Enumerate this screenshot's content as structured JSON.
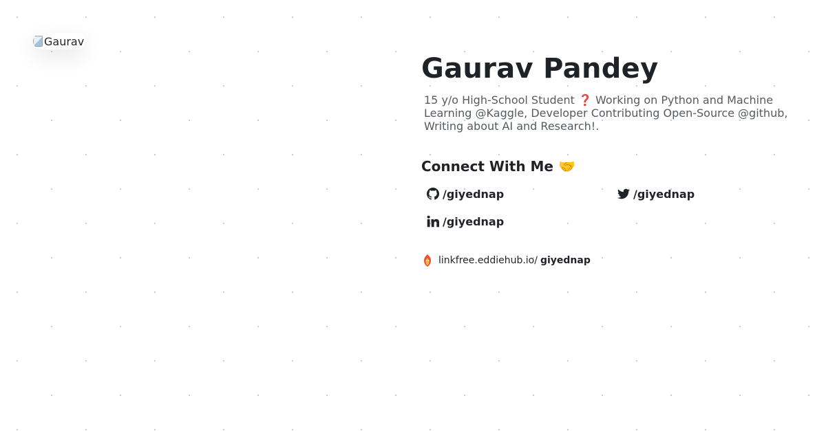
{
  "profile": {
    "avatar_alt": "Gaurav",
    "name": "Gaurav Pandey",
    "bio": "15 y/o High-School Student ❓ Working on Python and Machine Learning @Kaggle, Developer Contributing Open-Source @github, Writing about AI and Research!."
  },
  "connect": {
    "heading": "Connect With Me 🤝",
    "links": [
      {
        "icon": "github-icon",
        "label": "/giyednap"
      },
      {
        "icon": "twitter-icon",
        "label": "/giyednap"
      },
      {
        "icon": "linkedin-icon",
        "label": "/giyednap"
      }
    ]
  },
  "linkfree": {
    "icon": "linkfree-icon",
    "prefix": "linkfree.eddiehub.io/",
    "username": "giyednap"
  }
}
